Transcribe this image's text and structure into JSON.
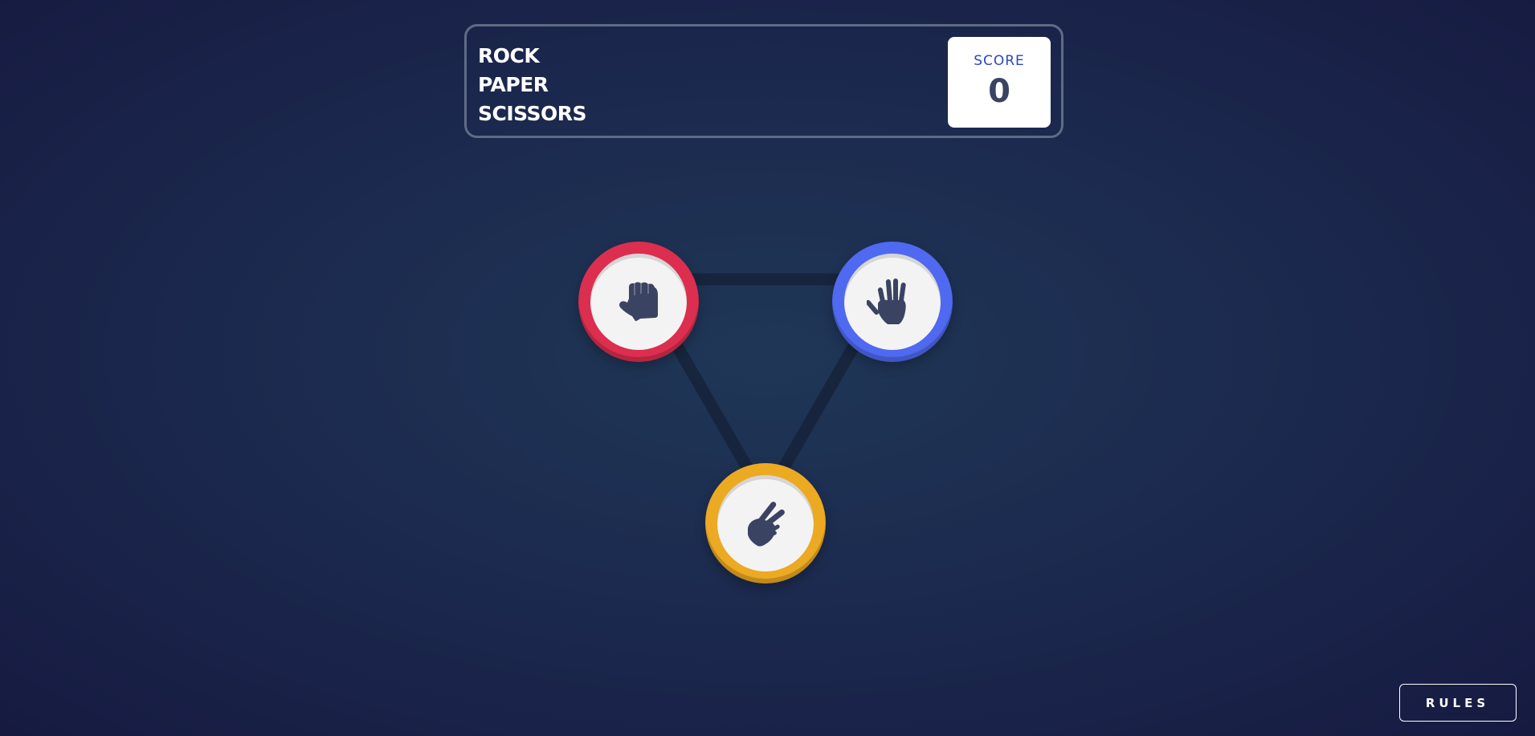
{
  "title": {
    "line1": "ROCK",
    "line2": "PAPER",
    "line3": "SCISSORS"
  },
  "score": {
    "label": "SCORE",
    "value": "0"
  },
  "choices": [
    {
      "id": "rock",
      "icon": "rock-fist-icon",
      "color": "#dc2e4e"
    },
    {
      "id": "paper",
      "icon": "paper-hand-icon",
      "color": "#4f69f0"
    },
    {
      "id": "scissors",
      "icon": "scissors-hand-icon",
      "color": "#eca922"
    }
  ],
  "rules_button": {
    "label": "RULES"
  },
  "colors": {
    "background": "#1c2a4f",
    "icon": "#3b4363",
    "triangle": "#16223a"
  }
}
